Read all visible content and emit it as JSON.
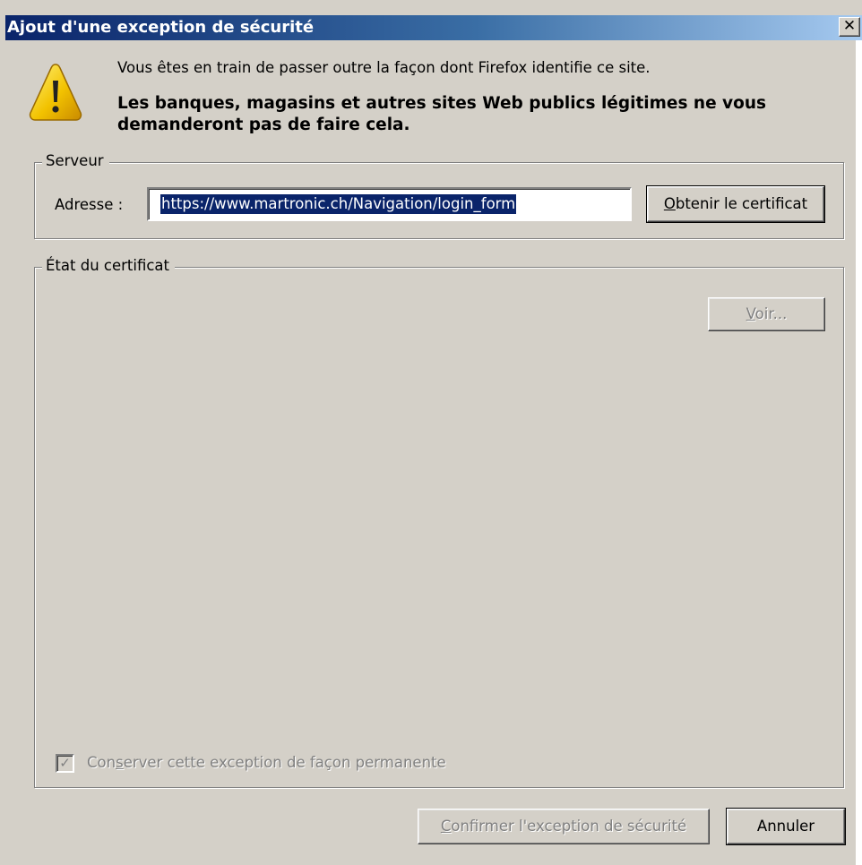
{
  "window": {
    "title": "Ajout d'une exception de sécurité",
    "close_icon": "close-icon"
  },
  "warning": {
    "icon": "warning-icon",
    "line1": "Vous êtes en train de passer outre la façon dont Firefox identifie ce site.",
    "line2": "Les banques, magasins et autres sites Web publics légitimes ne vous demanderont pas de faire cela."
  },
  "server": {
    "legend": "Serveur",
    "address_label": "Adresse :",
    "address_value": "https://www.martronic.ch/Navigation/login_form",
    "get_cert_label_prefix": "",
    "get_cert_accesskey": "O",
    "get_cert_label_rest": "btenir le certificat"
  },
  "certificate": {
    "legend": "État du certificat",
    "view_accesskey": "V",
    "view_label_rest": "oir...",
    "view_enabled": false
  },
  "permanent": {
    "checked": true,
    "enabled": false,
    "label_pre": "Con",
    "label_accesskey": "s",
    "label_post": "erver cette exception de façon permanente"
  },
  "buttons": {
    "confirm_accesskey": "C",
    "confirm_rest": "onfirmer l'exception de sécurité",
    "confirm_enabled": false,
    "cancel": "Annuler"
  },
  "colors": {
    "titlebar_start": "#0a246a",
    "titlebar_end": "#a6caf0",
    "dialog_bg": "#d4d0c8",
    "selection": "#0a246a",
    "disabled_text": "#808080",
    "warning_yellow": "#f2c200"
  }
}
